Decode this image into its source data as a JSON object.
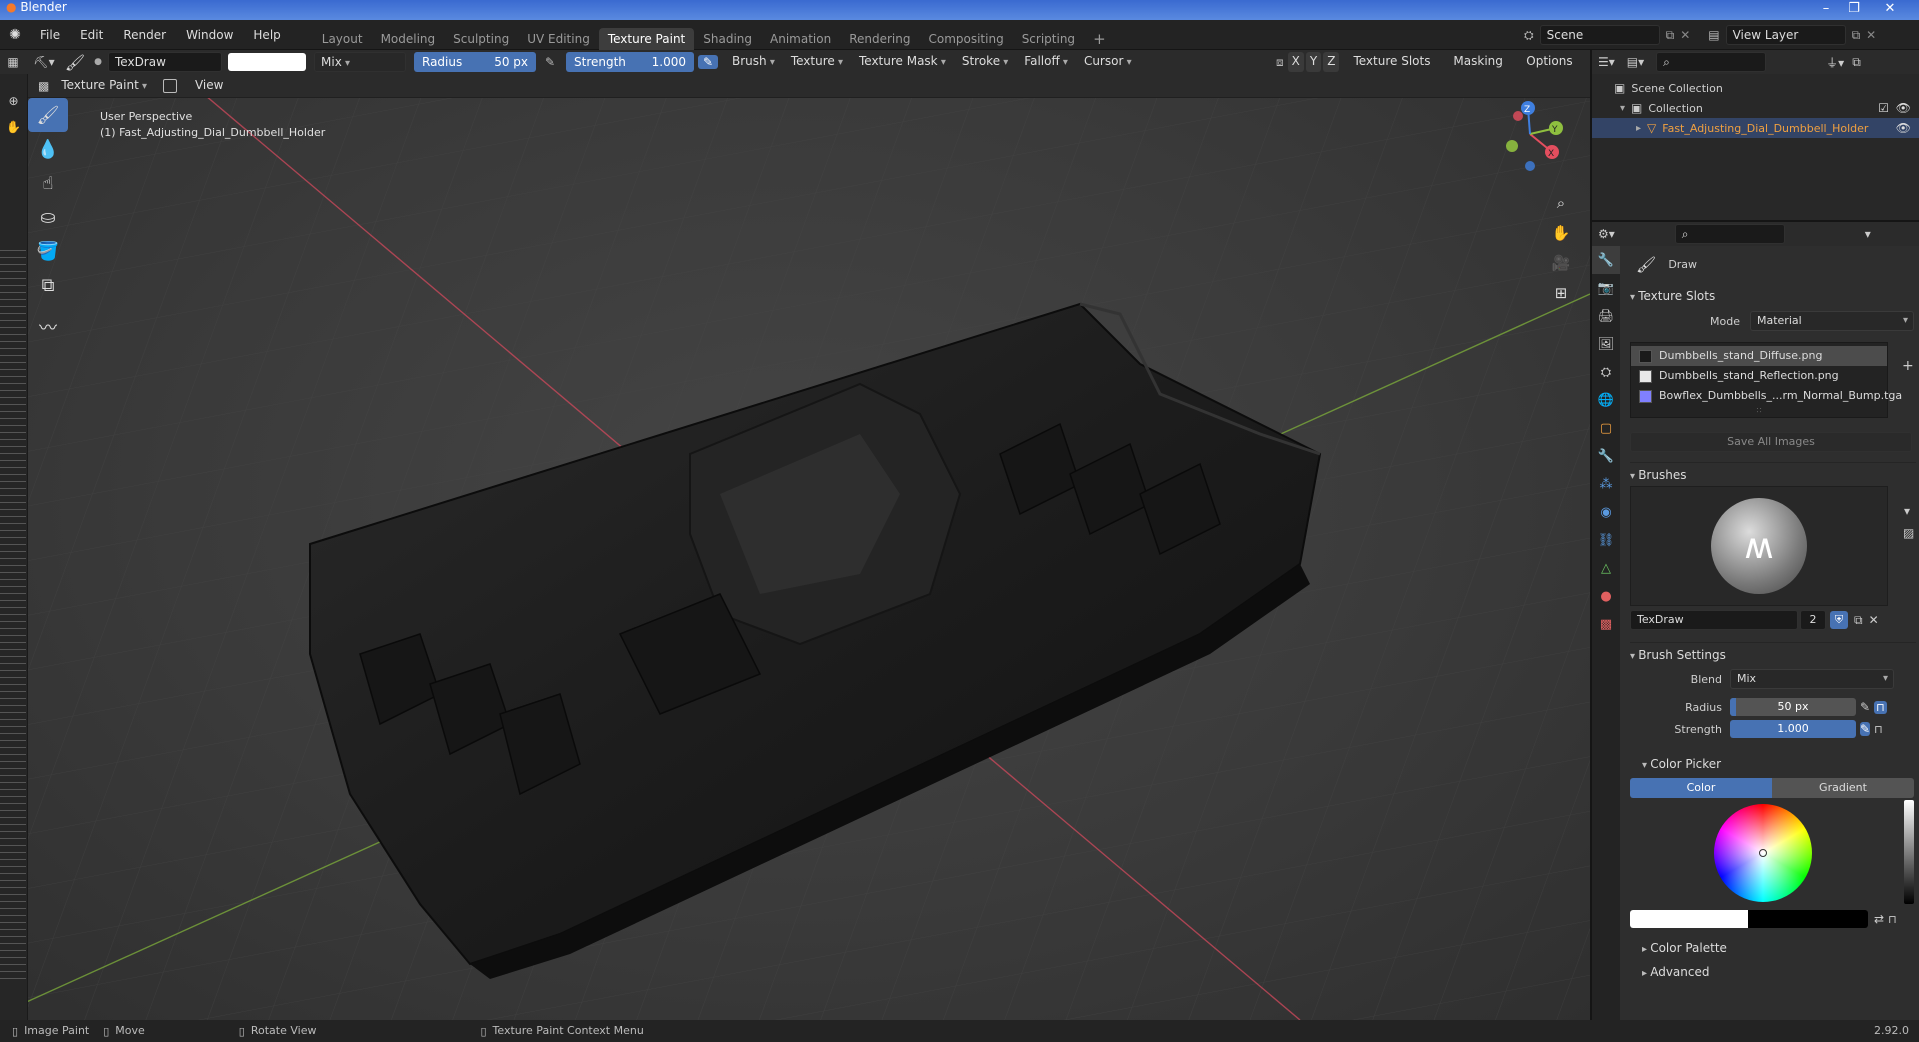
{
  "os": {
    "title": "Blender",
    "controls": [
      "–",
      "❐",
      "✕"
    ]
  },
  "menu": {
    "items": [
      "File",
      "Edit",
      "Render",
      "Window",
      "Help"
    ],
    "workspaces": [
      "Layout",
      "Modeling",
      "Sculpting",
      "UV Editing",
      "Texture Paint",
      "Shading",
      "Animation",
      "Rendering",
      "Compositing",
      "Scripting"
    ],
    "active_workspace": "Texture Paint",
    "add_tab": "+",
    "scene": "Scene",
    "view_layer": "View Layer"
  },
  "toolheader": {
    "brush_name": "TexDraw",
    "blend": "Mix",
    "radius_label": "Radius",
    "radius_value": "50 px",
    "strength_label": "Strength",
    "strength_value": "1.000",
    "menus": [
      "Brush",
      "Texture",
      "Texture Mask",
      "Stroke",
      "Falloff",
      "Cursor"
    ],
    "axes": [
      "X",
      "Y",
      "Z"
    ],
    "right_menus": [
      "Texture Slots",
      "Masking",
      "Options"
    ]
  },
  "subheader": {
    "mode": "Texture Paint",
    "view": "View"
  },
  "viewport": {
    "perspective": "User Perspective",
    "object_label": "(1) Fast_Adjusting_Dial_Dumbbell_Holder",
    "gizmo": {
      "x": "X",
      "y": "Y",
      "z": "Z"
    }
  },
  "outliner": {
    "scene_collection": "Scene Collection",
    "collection": "Collection",
    "object": "Fast_Adjusting_Dial_Dumbbell_Holder"
  },
  "properties": {
    "active_tool": "Draw",
    "texture_slots": {
      "title": "Texture Slots",
      "mode_label": "Mode",
      "mode_value": "Material",
      "items": [
        {
          "name": "Dumbbells_stand_Diffuse.png",
          "color": "#1a1a1a"
        },
        {
          "name": "Dumbbells_stand_Reflection.png",
          "color": "#e8e8e8"
        },
        {
          "name": "Bowflex_Dumbbells_...rm_Normal_Bump.tga",
          "color": "#8080ff"
        }
      ],
      "save_all": "Save All Images"
    },
    "brushes": {
      "title": "Brushes",
      "name": "TexDraw",
      "users": "2"
    },
    "brush_settings": {
      "title": "Brush Settings",
      "blend_label": "Blend",
      "blend_value": "Mix",
      "radius_label": "Radius",
      "radius_value": "50 px",
      "strength_label": "Strength",
      "strength_value": "1.000"
    },
    "color_picker": {
      "title": "Color Picker",
      "tab_color": "Color",
      "tab_gradient": "Gradient"
    },
    "color_palette": "Color Palette",
    "advanced": "Advanced"
  },
  "statusbar": {
    "image_paint": "Image Paint",
    "move": "Move",
    "rotate_view": "Rotate View",
    "context_menu": "Texture Paint Context Menu",
    "version": "2.92.0"
  },
  "colors": {
    "accent": "#4772b3",
    "x_axis": "#e34e5e",
    "y_axis": "#8fbf3f",
    "z_axis": "#3f7fdf",
    "selected_object": "#f0a040"
  }
}
